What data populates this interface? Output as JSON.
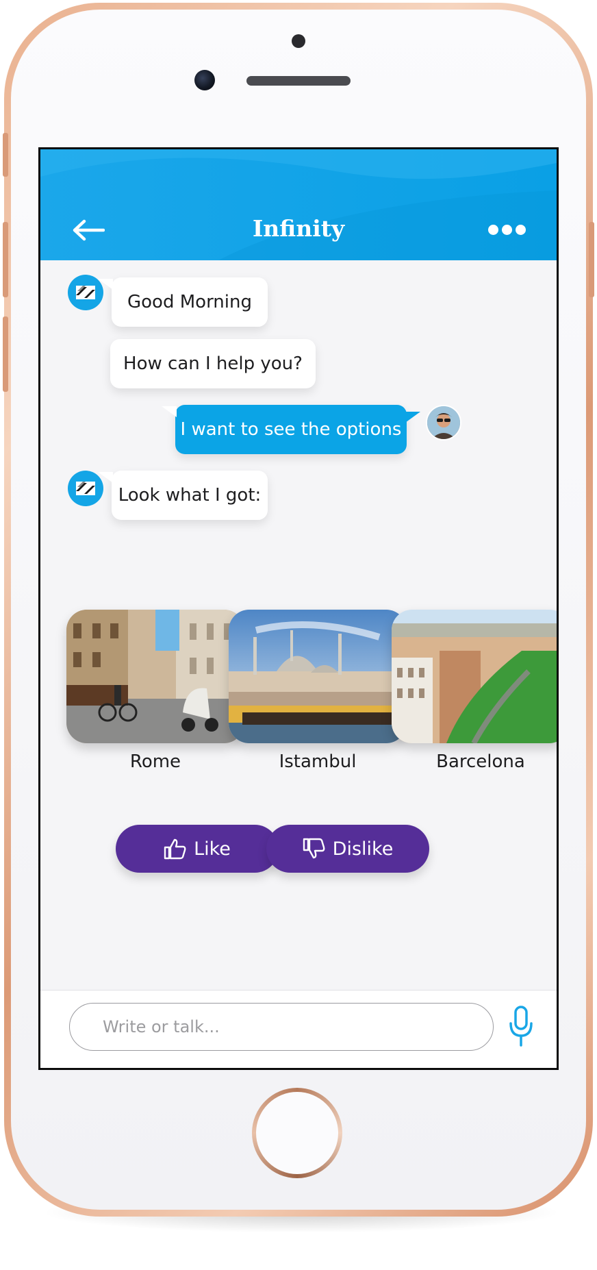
{
  "header": {
    "title": "Infinity"
  },
  "messages": [
    {
      "from": "bot",
      "text": "Good Morning"
    },
    {
      "from": "bot",
      "text": "How can I help you?"
    },
    {
      "from": "user",
      "text": "I want to see the options"
    },
    {
      "from": "bot",
      "text": "Look what I got:"
    }
  ],
  "cards": [
    {
      "label": "Rome"
    },
    {
      "label": "Istambul"
    },
    {
      "label": "Barcelona"
    }
  ],
  "actions": {
    "like_label": "Like",
    "dislike_label": "Dislike"
  },
  "composer": {
    "placeholder": "Write or talk..."
  },
  "colors": {
    "header_blue": "#0aa0e5",
    "user_bubble": "#0ba4e6",
    "action_purple": "#552e98",
    "mic_blue": "#19a6e6"
  },
  "icons": [
    "back-arrow-icon",
    "more-dots-icon",
    "bot-avatar-icon",
    "user-avatar",
    "thumbs-up-icon",
    "thumbs-down-icon",
    "microphone-icon"
  ]
}
